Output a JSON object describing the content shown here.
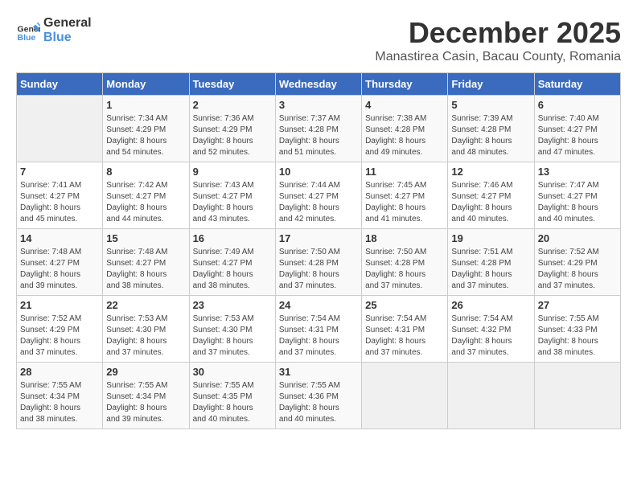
{
  "logo": {
    "line1": "General",
    "line2": "Blue"
  },
  "title": "December 2025",
  "subtitle": "Manastirea Casin, Bacau County, Romania",
  "weekdays": [
    "Sunday",
    "Monday",
    "Tuesday",
    "Wednesday",
    "Thursday",
    "Friday",
    "Saturday"
  ],
  "weeks": [
    [
      {
        "day": "",
        "info": ""
      },
      {
        "day": "1",
        "info": "Sunrise: 7:34 AM\nSunset: 4:29 PM\nDaylight: 8 hours\nand 54 minutes."
      },
      {
        "day": "2",
        "info": "Sunrise: 7:36 AM\nSunset: 4:29 PM\nDaylight: 8 hours\nand 52 minutes."
      },
      {
        "day": "3",
        "info": "Sunrise: 7:37 AM\nSunset: 4:28 PM\nDaylight: 8 hours\nand 51 minutes."
      },
      {
        "day": "4",
        "info": "Sunrise: 7:38 AM\nSunset: 4:28 PM\nDaylight: 8 hours\nand 49 minutes."
      },
      {
        "day": "5",
        "info": "Sunrise: 7:39 AM\nSunset: 4:28 PM\nDaylight: 8 hours\nand 48 minutes."
      },
      {
        "day": "6",
        "info": "Sunrise: 7:40 AM\nSunset: 4:27 PM\nDaylight: 8 hours\nand 47 minutes."
      }
    ],
    [
      {
        "day": "7",
        "info": "Sunrise: 7:41 AM\nSunset: 4:27 PM\nDaylight: 8 hours\nand 45 minutes."
      },
      {
        "day": "8",
        "info": "Sunrise: 7:42 AM\nSunset: 4:27 PM\nDaylight: 8 hours\nand 44 minutes."
      },
      {
        "day": "9",
        "info": "Sunrise: 7:43 AM\nSunset: 4:27 PM\nDaylight: 8 hours\nand 43 minutes."
      },
      {
        "day": "10",
        "info": "Sunrise: 7:44 AM\nSunset: 4:27 PM\nDaylight: 8 hours\nand 42 minutes."
      },
      {
        "day": "11",
        "info": "Sunrise: 7:45 AM\nSunset: 4:27 PM\nDaylight: 8 hours\nand 41 minutes."
      },
      {
        "day": "12",
        "info": "Sunrise: 7:46 AM\nSunset: 4:27 PM\nDaylight: 8 hours\nand 40 minutes."
      },
      {
        "day": "13",
        "info": "Sunrise: 7:47 AM\nSunset: 4:27 PM\nDaylight: 8 hours\nand 40 minutes."
      }
    ],
    [
      {
        "day": "14",
        "info": "Sunrise: 7:48 AM\nSunset: 4:27 PM\nDaylight: 8 hours\nand 39 minutes."
      },
      {
        "day": "15",
        "info": "Sunrise: 7:48 AM\nSunset: 4:27 PM\nDaylight: 8 hours\nand 38 minutes."
      },
      {
        "day": "16",
        "info": "Sunrise: 7:49 AM\nSunset: 4:27 PM\nDaylight: 8 hours\nand 38 minutes."
      },
      {
        "day": "17",
        "info": "Sunrise: 7:50 AM\nSunset: 4:28 PM\nDaylight: 8 hours\nand 37 minutes."
      },
      {
        "day": "18",
        "info": "Sunrise: 7:50 AM\nSunset: 4:28 PM\nDaylight: 8 hours\nand 37 minutes."
      },
      {
        "day": "19",
        "info": "Sunrise: 7:51 AM\nSunset: 4:28 PM\nDaylight: 8 hours\nand 37 minutes."
      },
      {
        "day": "20",
        "info": "Sunrise: 7:52 AM\nSunset: 4:29 PM\nDaylight: 8 hours\nand 37 minutes."
      }
    ],
    [
      {
        "day": "21",
        "info": "Sunrise: 7:52 AM\nSunset: 4:29 PM\nDaylight: 8 hours\nand 37 minutes."
      },
      {
        "day": "22",
        "info": "Sunrise: 7:53 AM\nSunset: 4:30 PM\nDaylight: 8 hours\nand 37 minutes."
      },
      {
        "day": "23",
        "info": "Sunrise: 7:53 AM\nSunset: 4:30 PM\nDaylight: 8 hours\nand 37 minutes."
      },
      {
        "day": "24",
        "info": "Sunrise: 7:54 AM\nSunset: 4:31 PM\nDaylight: 8 hours\nand 37 minutes."
      },
      {
        "day": "25",
        "info": "Sunrise: 7:54 AM\nSunset: 4:31 PM\nDaylight: 8 hours\nand 37 minutes."
      },
      {
        "day": "26",
        "info": "Sunrise: 7:54 AM\nSunset: 4:32 PM\nDaylight: 8 hours\nand 37 minutes."
      },
      {
        "day": "27",
        "info": "Sunrise: 7:55 AM\nSunset: 4:33 PM\nDaylight: 8 hours\nand 38 minutes."
      }
    ],
    [
      {
        "day": "28",
        "info": "Sunrise: 7:55 AM\nSunset: 4:34 PM\nDaylight: 8 hours\nand 38 minutes."
      },
      {
        "day": "29",
        "info": "Sunrise: 7:55 AM\nSunset: 4:34 PM\nDaylight: 8 hours\nand 39 minutes."
      },
      {
        "day": "30",
        "info": "Sunrise: 7:55 AM\nSunset: 4:35 PM\nDaylight: 8 hours\nand 40 minutes."
      },
      {
        "day": "31",
        "info": "Sunrise: 7:55 AM\nSunset: 4:36 PM\nDaylight: 8 hours\nand 40 minutes."
      },
      {
        "day": "",
        "info": ""
      },
      {
        "day": "",
        "info": ""
      },
      {
        "day": "",
        "info": ""
      }
    ]
  ]
}
